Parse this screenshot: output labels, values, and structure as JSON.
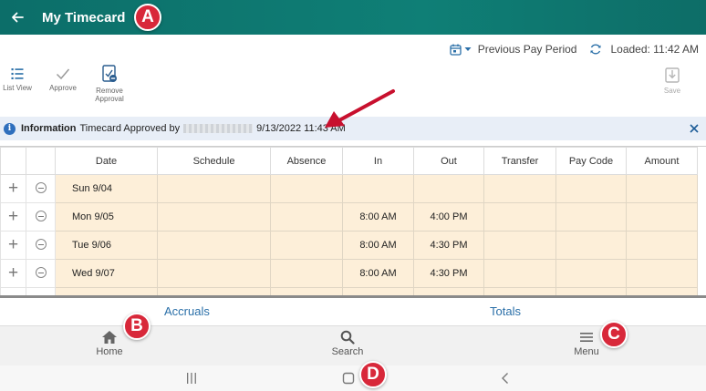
{
  "header": {
    "title": "My Timecard"
  },
  "callouts": {
    "a": "A",
    "b": "B",
    "c": "C",
    "d": "D"
  },
  "period_bar": {
    "period_label": "Previous Pay Period",
    "loaded_label": "Loaded: 11:42 AM"
  },
  "toolbar": {
    "list_view": "List View",
    "approve": "Approve",
    "remove_approval_line1": "Remove",
    "remove_approval_line2": "Approval",
    "save": "Save"
  },
  "banner": {
    "label": "Information",
    "message": "Timecard Approved by",
    "timestamp": "9/13/2022 11:43 AM"
  },
  "table": {
    "columns": [
      "Date",
      "Schedule",
      "Absence",
      "In",
      "Out",
      "Transfer",
      "Pay Code",
      "Amount"
    ],
    "rows": [
      {
        "date": "Sun 9/04",
        "schedule": "",
        "absence": "",
        "in": "",
        "out": "",
        "transfer": "",
        "pay_code": "",
        "amount": ""
      },
      {
        "date": "Mon 9/05",
        "schedule": "",
        "absence": "",
        "in": "8:00 AM",
        "out": "4:00 PM",
        "transfer": "",
        "pay_code": "",
        "amount": ""
      },
      {
        "date": "Tue 9/06",
        "schedule": "",
        "absence": "",
        "in": "8:00 AM",
        "out": "4:30 PM",
        "transfer": "",
        "pay_code": "",
        "amount": ""
      },
      {
        "date": "Wed 9/07",
        "schedule": "",
        "absence": "",
        "in": "8:00 AM",
        "out": "4:30 PM",
        "transfer": "",
        "pay_code": "",
        "amount": ""
      }
    ]
  },
  "subtabs": {
    "accruals": "Accruals",
    "totals": "Totals"
  },
  "bottom_nav": {
    "home": "Home",
    "search": "Search",
    "menu": "Menu"
  },
  "colors": {
    "header_bg": "#0f7f76",
    "accent_blue": "#2a6fa8",
    "row_bg": "#fdefd9",
    "banner_bg": "#e8eef7",
    "callout_red": "#d8283a"
  }
}
